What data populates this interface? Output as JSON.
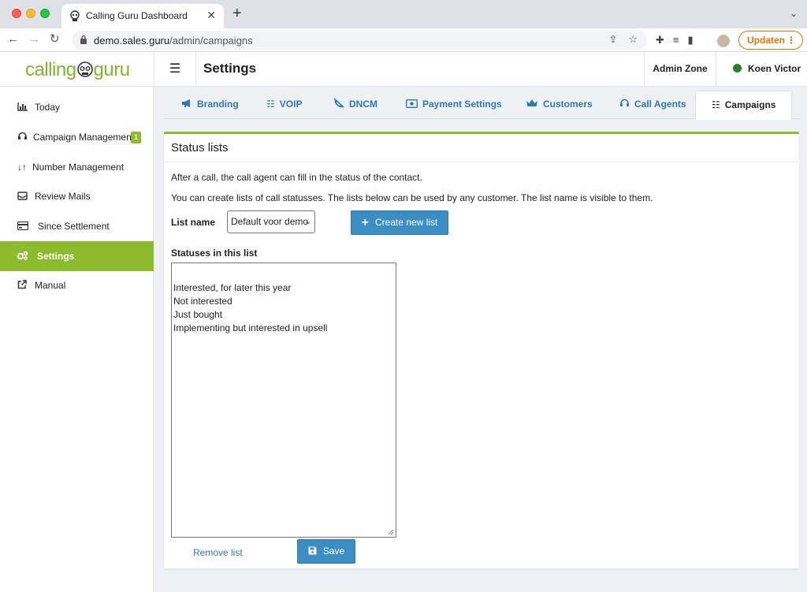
{
  "browser": {
    "tab_title": "Calling Guru Dashboard",
    "url_domain": "demo.sales.guru",
    "url_path": "/admin/campaigns",
    "update_label": "Updaten"
  },
  "header": {
    "logo_left": "calling",
    "logo_right": "guru",
    "page_title": "Settings",
    "admin_zone": "Admin Zone",
    "user_name": "Koen Victor"
  },
  "sidebar": {
    "items": [
      {
        "label": "Today",
        "icon": "bar-chart-icon"
      },
      {
        "label": "Campaign Management",
        "icon": "headset-icon",
        "badge": "1"
      },
      {
        "label": "Number Management",
        "icon": "sort-icon"
      },
      {
        "label": "Review Mails",
        "icon": "inbox-icon"
      },
      {
        "label": "Since Settlement",
        "icon": "card-icon"
      },
      {
        "label": "Settings",
        "icon": "gears-icon",
        "active": true
      },
      {
        "label": "Manual",
        "icon": "external-link-icon"
      }
    ]
  },
  "tabs": [
    {
      "label": "Branding",
      "icon": "megaphone-icon"
    },
    {
      "label": "VOIP",
      "icon": "list-icon"
    },
    {
      "label": "DNCM",
      "icon": "phone-slash-icon"
    },
    {
      "label": "Payment Settings",
      "icon": "money-icon"
    },
    {
      "label": "Customers",
      "icon": "crown-icon"
    },
    {
      "label": "Call Agents",
      "icon": "headset-icon"
    },
    {
      "label": "Campaigns",
      "icon": "list-icon",
      "active": true
    }
  ],
  "card": {
    "title": "Status lists",
    "description_1": "After a call, the call agent can fill in the status of the contact.",
    "description_2": "You can create lists of call statusses. The lists below can be used by any customer. The list name is visible to them.",
    "list_name_label": "List name",
    "list_name_selected": "Default voor demo",
    "create_button": "Create new list",
    "statuses_label": "Statuses in this list",
    "statuses": [
      "",
      "Interested, for later this year",
      "Not interested",
      "Just bought",
      "Implementing but interested in upsell"
    ],
    "remove_link": "Remove list",
    "save_button": "Save"
  },
  "colors": {
    "brand_green": "#8cbb2c",
    "link_blue": "#2e7bb0",
    "button_blue": "#3a8ec4"
  }
}
